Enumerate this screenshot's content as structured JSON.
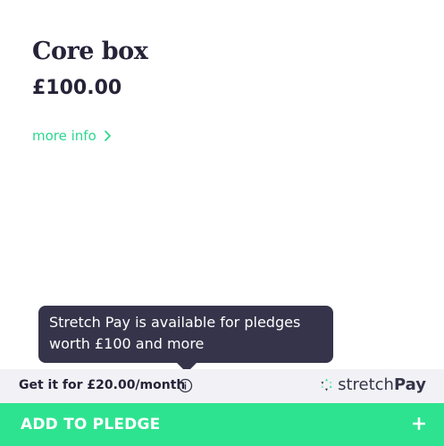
{
  "reward": {
    "title": "Core box",
    "price": "£100.00",
    "more_info_label": "more info",
    "more_info_icon": "chevron-right-icon"
  },
  "tooltip": {
    "line1": "Stretch Pay is available for pledges",
    "line2": "worth £100 and more"
  },
  "installment": {
    "text": "Get it for £20.00/month",
    "info_icon": "info-icon",
    "brand_prefix": "stretch",
    "brand_suffix": "Pay",
    "brand_logo": "stretchpay-logo-icon"
  },
  "cta": {
    "label": "ADD TO PLEDGE",
    "icon": "plus-icon"
  },
  "colors": {
    "accent_green": "#2ee390",
    "link_green": "#2bd88f",
    "dark": "#35344a",
    "text": "#262338",
    "strip": "#f2f2f6"
  }
}
